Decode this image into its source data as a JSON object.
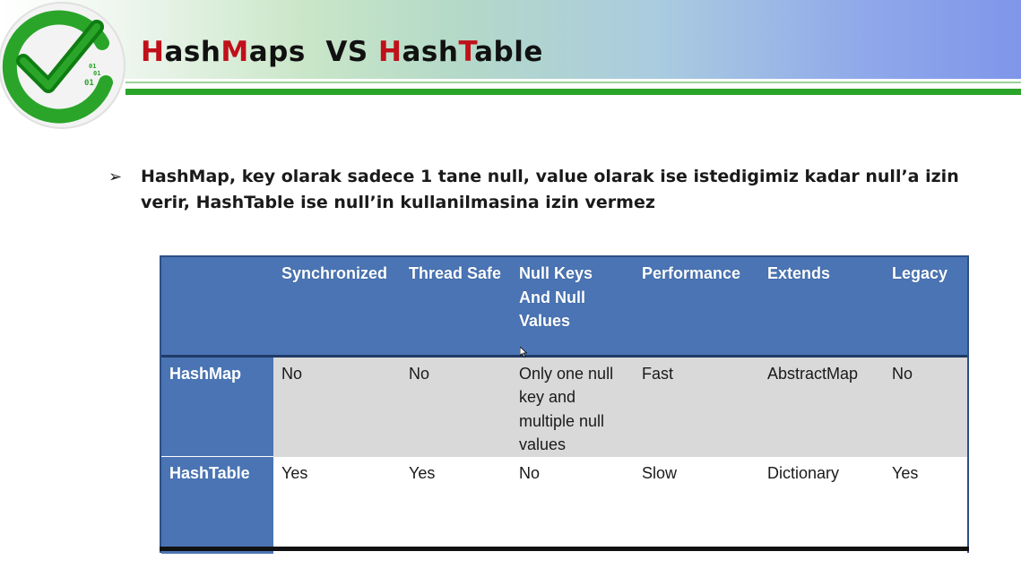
{
  "title": {
    "part1_red": "H",
    "part2": "ash",
    "part3_red": "M",
    "part4": "aps  VS ",
    "part5_red": "H",
    "part6": "ash",
    "part7_red": "T",
    "part8": "able"
  },
  "logo": {
    "binary_line1": "01",
    "binary_line2": "01",
    "binary_line3": "01",
    "icon": "checkmark-icon",
    "color": "#2aa52a"
  },
  "bullet": {
    "marker": "➢",
    "text": "HashMap, key olarak sadece 1 tane null, value olarak ise istedigimiz kadar null’a izin verir, HashTable ise null’in kullanilmasina izin vermez"
  },
  "table": {
    "columns": [
      "",
      "Synchronized",
      "Thread Safe",
      "Null Keys And Null Values",
      "Performance",
      "Extends",
      "Legacy"
    ],
    "rows": [
      {
        "name": "HashMap",
        "cells": [
          "No",
          "No",
          "Only one null key and multiple null values",
          "Fast",
          "AbstractMap",
          "No"
        ]
      },
      {
        "name": "HashTable",
        "cells": [
          "Yes",
          "Yes",
          "No",
          "Slow",
          "Dictionary",
          "Yes"
        ]
      }
    ]
  },
  "colors": {
    "header_blue": "#4a74b3",
    "accent_red": "#c0101a",
    "accent_green": "#2aa52a"
  }
}
